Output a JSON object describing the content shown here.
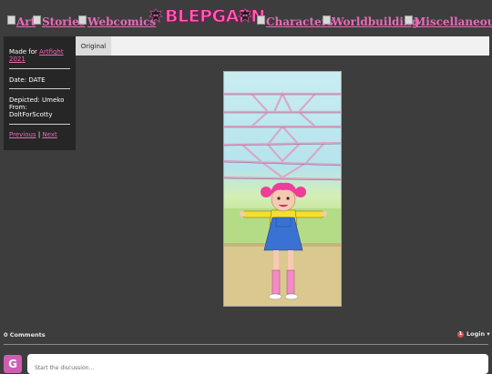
{
  "nav": {
    "links": [
      "Art",
      "Stories",
      "Webcomics",
      "Characters",
      "Worldbuilding",
      "Miscellaneous"
    ],
    "logo_text": "BLEPGAPN"
  },
  "info": {
    "made_for_prefix": "Made for",
    "made_for_link": "Artfight 2021",
    "date": "Date: DATE",
    "depicted": "Depicted: Umeko",
    "from_label": "From:",
    "from_value": "DoltForScotty",
    "previous": "Previous",
    "separator": "|",
    "next": "Next"
  },
  "tabs": [
    "Original"
  ],
  "comments": {
    "count_label": "0 Comments",
    "notification_count": "1",
    "login_label": "Login ▾",
    "avatar_letter": "G",
    "input_placeholder": "Start the discussion..."
  },
  "colors": {
    "background": "#3d3d3d",
    "panel": "#262626",
    "link_pink": "#e86ab8",
    "logo_pink": "#ff5fb3"
  }
}
